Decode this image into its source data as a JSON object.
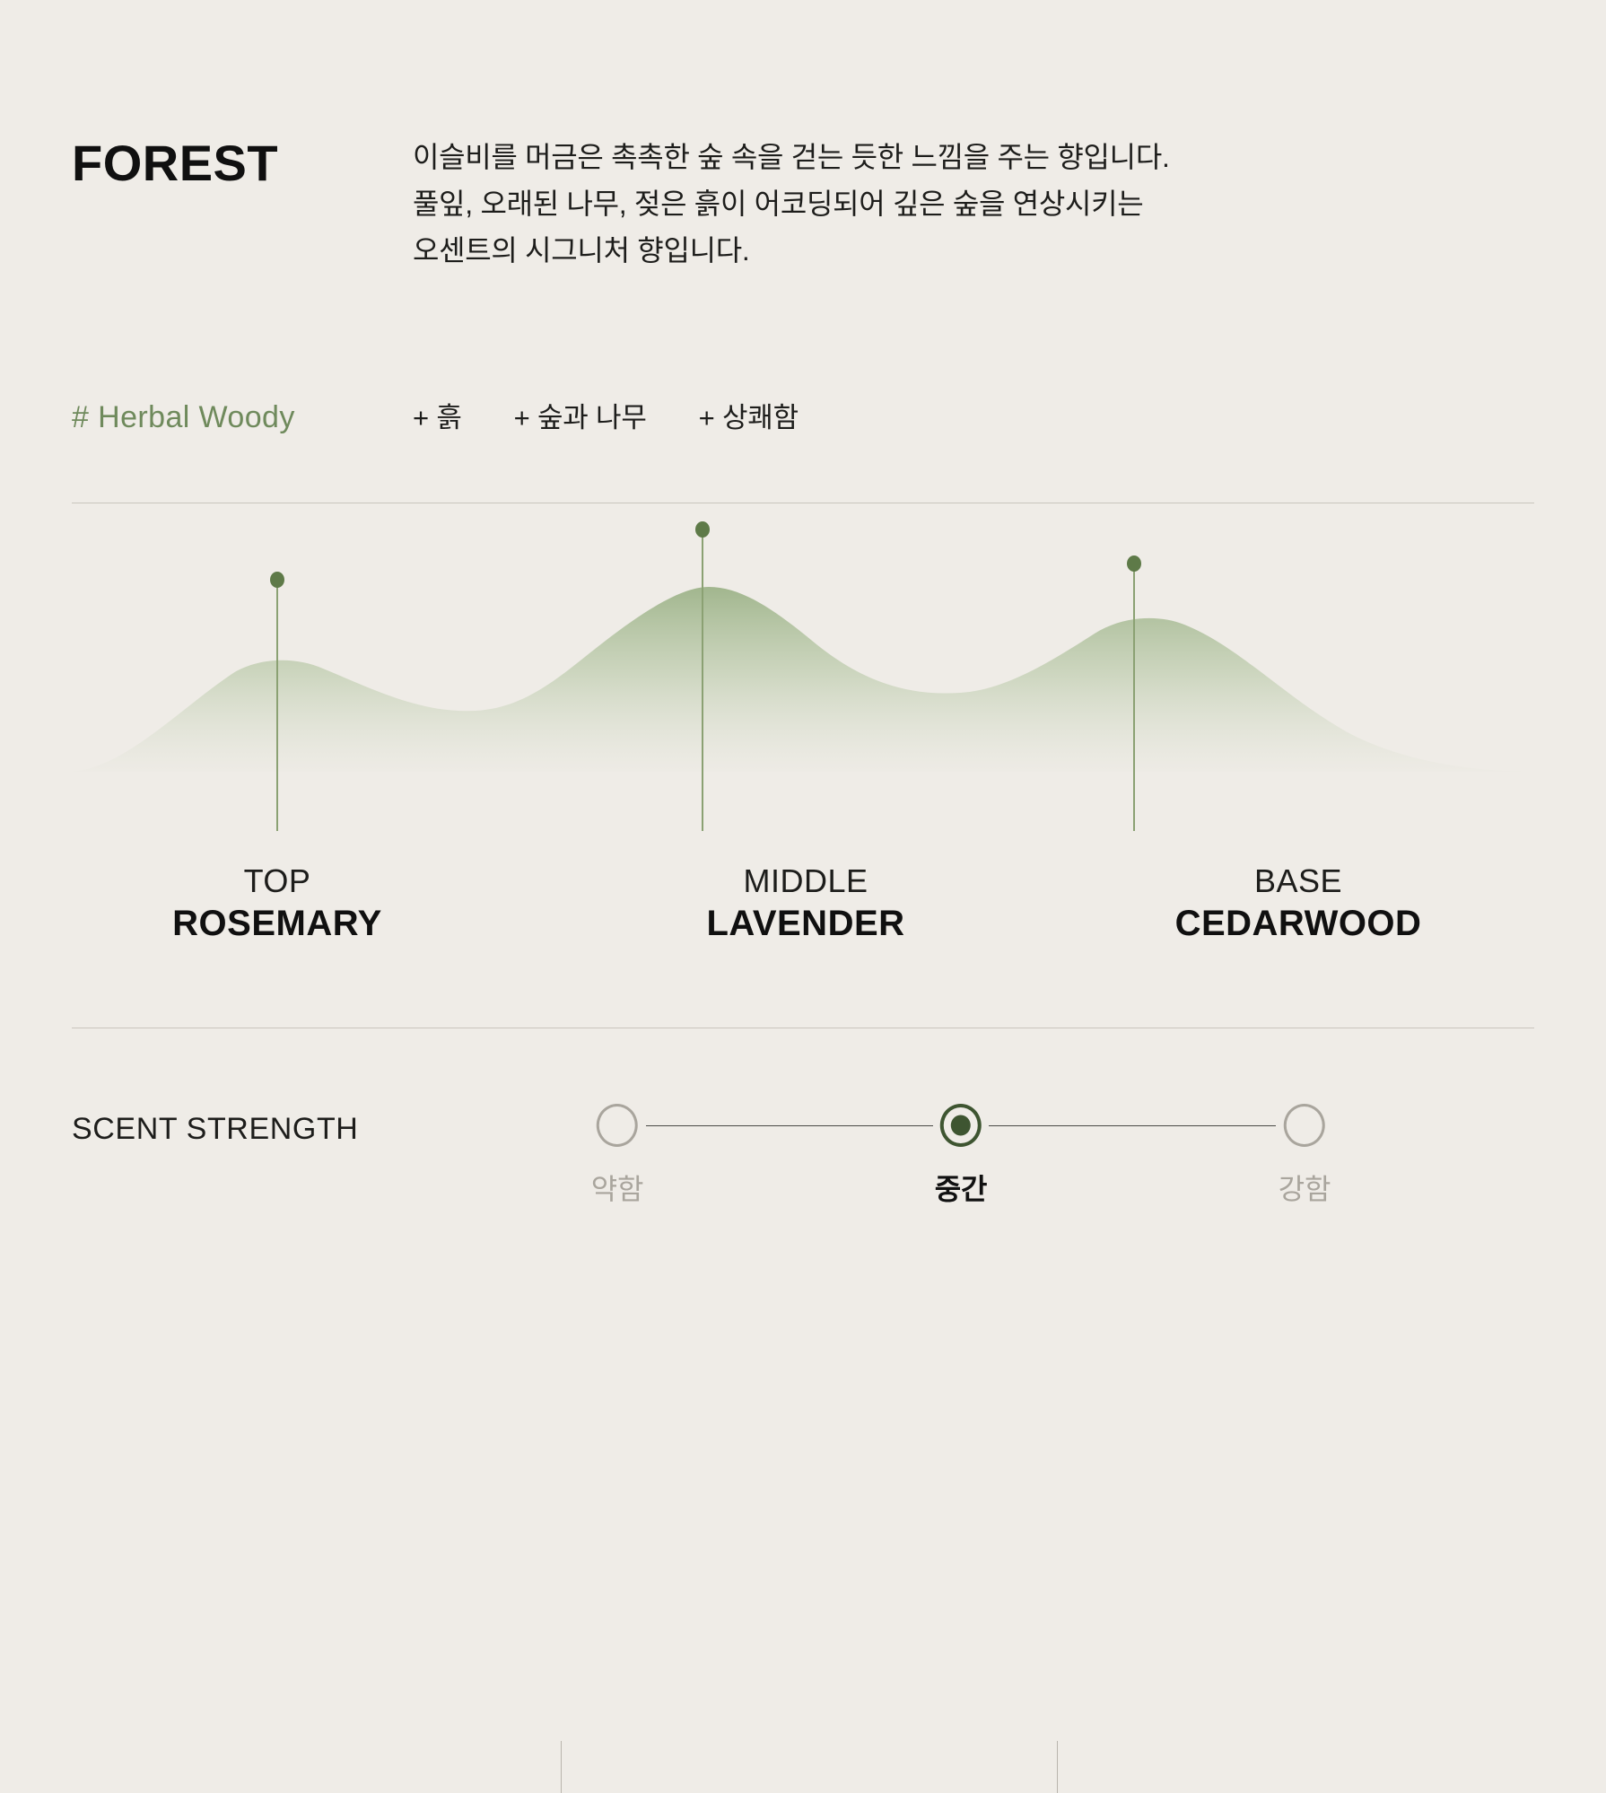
{
  "header": {
    "title": "FOREST",
    "description_lines": [
      "이슬비를 머금은 촉촉한 숲 속을 걷는 듯한 느낌을 주는 향입니다.",
      "풀잎, 오래된 나무, 젖은 흙이 어코딩되어 깊은 숲을 연상시키는",
      "오센트의 시그니처 향입니다."
    ]
  },
  "tags": {
    "primary": "# Herbal Woody",
    "items": [
      "+ 흙",
      "+ 숲과 나무",
      "+ 상쾌함"
    ]
  },
  "notes": {
    "items": [
      {
        "stage": "TOP",
        "name": "ROSEMARY"
      },
      {
        "stage": "MIDDLE",
        "name": "LAVENDER"
      },
      {
        "stage": "BASE",
        "name": "CEDARWOOD"
      }
    ]
  },
  "strength": {
    "label": "SCENT STRENGTH",
    "steps": [
      {
        "caption": "약함",
        "selected": false
      },
      {
        "caption": "중간",
        "selected": true
      },
      {
        "caption": "강함",
        "selected": false
      }
    ]
  },
  "colors": {
    "background": "#efece7",
    "accent_green": "#6f8a5c",
    "wave_green": "#9db389",
    "marker_green": "#5e7a48",
    "selected_green": "#3e5531",
    "muted_gray": "#a9a59d",
    "divider": "#c9c5bd"
  },
  "chart_data": {
    "type": "area",
    "title": "Scent note intensity curve",
    "xlabel": "",
    "ylabel": "",
    "grid": false,
    "legend": "none",
    "xlim": [
      0,
      1790
    ],
    "ylim": [
      0,
      1
    ],
    "markers": [
      {
        "label": "TOP / ROSEMARY",
        "x": 309,
        "y": 0.62
      },
      {
        "label": "MIDDLE / LAVENDER",
        "x": 783,
        "y": 1.0
      },
      {
        "label": "BASE / CEDARWOOD",
        "x": 1264,
        "y": 0.68
      }
    ],
    "curve_points": [
      {
        "x": 90,
        "y": 0.0
      },
      {
        "x": 180,
        "y": 0.3
      },
      {
        "x": 309,
        "y": 0.62
      },
      {
        "x": 430,
        "y": 0.62
      },
      {
        "x": 560,
        "y": 0.44
      },
      {
        "x": 660,
        "y": 0.72
      },
      {
        "x": 783,
        "y": 1.0
      },
      {
        "x": 900,
        "y": 0.95
      },
      {
        "x": 1030,
        "y": 0.56
      },
      {
        "x": 1150,
        "y": 0.56
      },
      {
        "x": 1264,
        "y": 0.68
      },
      {
        "x": 1400,
        "y": 0.58
      },
      {
        "x": 1540,
        "y": 0.3
      },
      {
        "x": 1700,
        "y": 0.05
      }
    ]
  }
}
